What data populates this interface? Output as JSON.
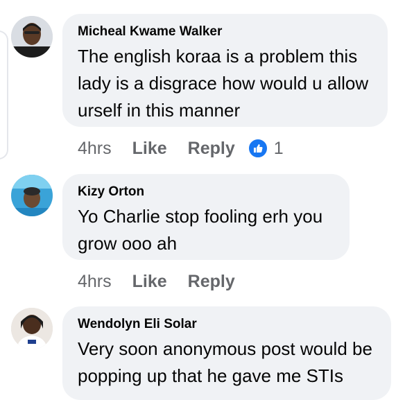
{
  "comments": [
    {
      "author": "Micheal Kwame Walker",
      "text": "The english koraa is a problem this lady is a disgrace how would u allow urself in this manner",
      "time": "4hrs",
      "like_label": "Like",
      "reply_label": "Reply",
      "reaction_count": "1",
      "reaction_icon": "like-icon"
    },
    {
      "author": "Kizy Orton",
      "text": "Yo Charlie stop fooling erh you grow ooo ah",
      "time": "4hrs",
      "like_label": "Like",
      "reply_label": "Reply"
    },
    {
      "author": "Wendolyn Eli Solar",
      "text": "Very soon anonymous post would be popping up that he gave me STIs"
    }
  ],
  "colors": {
    "bubble": "#f0f2f5",
    "text": "#050505",
    "meta": "#65676b",
    "like_blue": "#1877f2"
  }
}
